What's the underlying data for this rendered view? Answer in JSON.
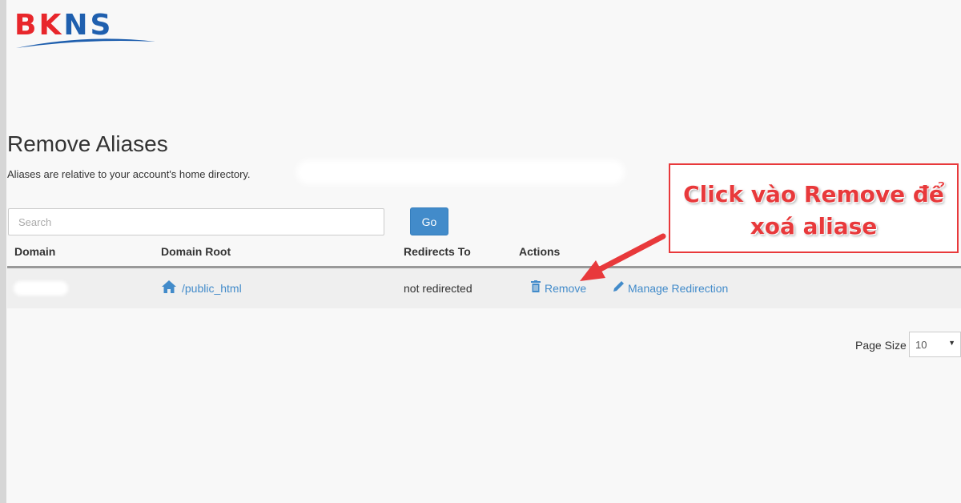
{
  "brand": {
    "logo_text": "BKNS",
    "logo_red_part": "BK",
    "logo_blue_part": "NS"
  },
  "header": {
    "title": "Remove Aliases",
    "description": "Aliases are relative to your account's home directory."
  },
  "search": {
    "placeholder": "Search",
    "go_label": "Go"
  },
  "table": {
    "columns": [
      "Domain",
      "Domain Root",
      "Redirects To",
      "Actions"
    ],
    "rows": [
      {
        "domain": "",
        "domain_root": "/public_html",
        "redirects_to": "not redirected",
        "actions": {
          "remove": "Remove",
          "manage": "Manage Redirection"
        }
      }
    ]
  },
  "pagination": {
    "page_size_label": "Page Size",
    "page_size_value": "10"
  },
  "annotation": {
    "line1": "Click vào Remove để",
    "line2": "xoá aliase"
  },
  "colors": {
    "accent": "#428bca",
    "annotation_red": "#e8393b",
    "logo_red": "#e8262b",
    "logo_blue": "#1f5fae"
  },
  "icons": {
    "domain_root": "home-icon",
    "remove": "trash-icon",
    "manage": "pencil-icon"
  }
}
